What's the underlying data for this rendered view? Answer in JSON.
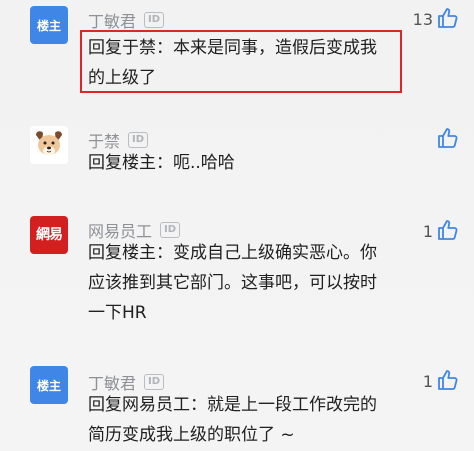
{
  "comments": [
    {
      "avatar_label": "楼主",
      "name": "丁敏君",
      "id_badge": "ID",
      "text": "回复于禁：本来是同事，造假后变成我\n的上级了",
      "likes": "13"
    },
    {
      "avatar_label": "dog-face-avatar",
      "name": "于禁",
      "id_badge": "ID",
      "text": "回复楼主：呃..哈哈",
      "likes": ""
    },
    {
      "avatar_label": "網易",
      "name": "网易员工",
      "id_badge": "ID",
      "text": "回复楼主：变成自己上级确实恶心。你\n应该推到其它部门。这事吧，可以按时\n一下HR",
      "likes": "1"
    },
    {
      "avatar_label": "楼主",
      "name": "丁敏君",
      "id_badge": "ID",
      "text": "回复网易员工：就是上一段工作改完的\n简历变成我上级的职位了 ~",
      "likes": "1"
    }
  ],
  "colors": {
    "highlight_border": "#e12525",
    "louzhu_avatar": "#3f86e6",
    "netease_avatar": "#d21f1f"
  }
}
